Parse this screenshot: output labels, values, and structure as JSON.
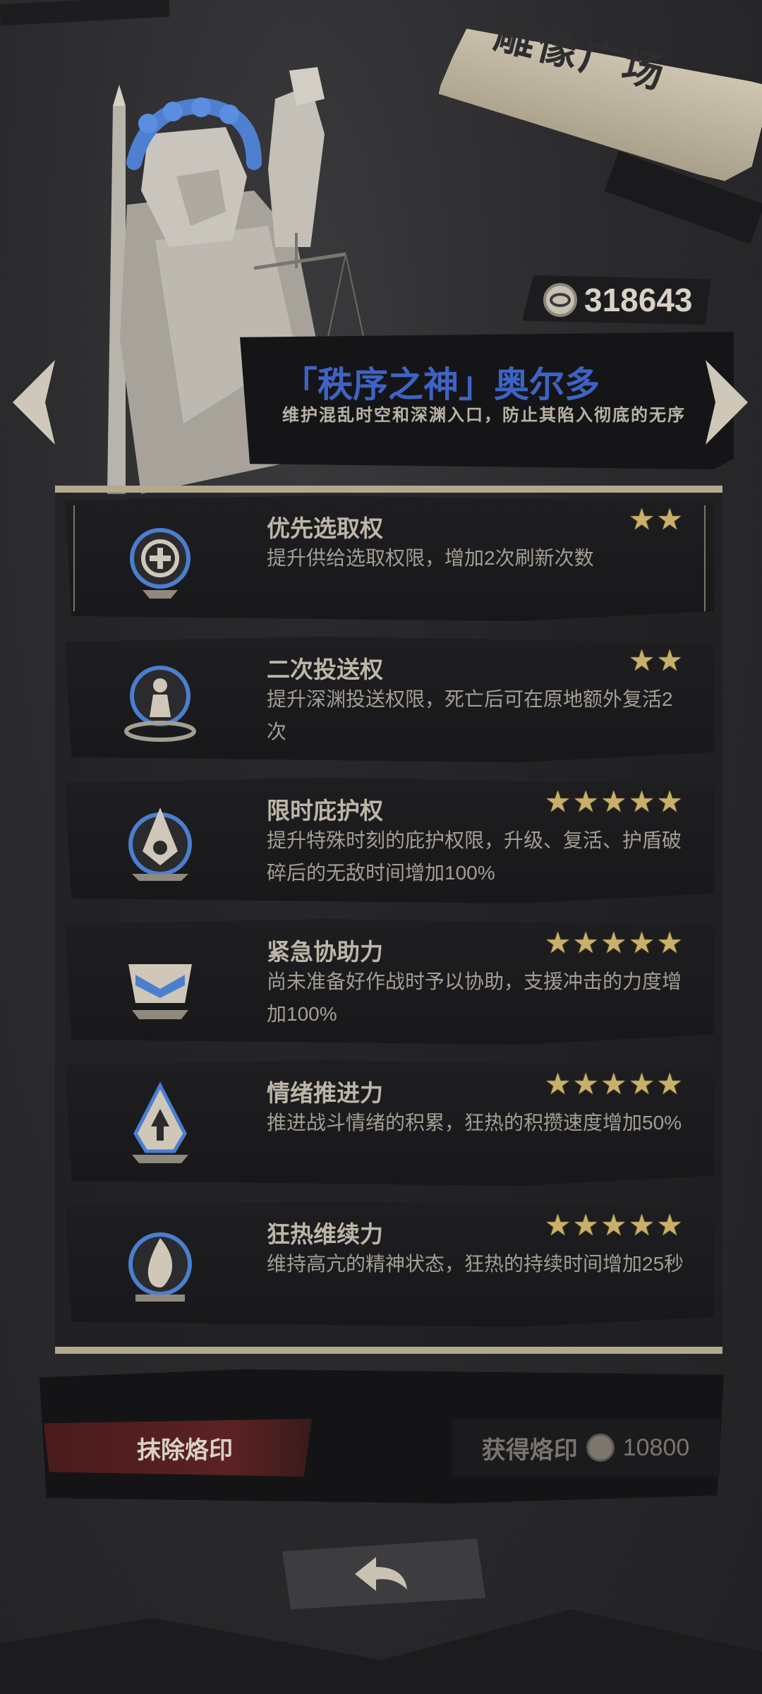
{
  "header": {
    "title": "雕像广场"
  },
  "currency": {
    "icon": "coin-icon",
    "value": "318643"
  },
  "character": {
    "name": "「秩序之神」奥尔多",
    "description": "维护混乱时空和深渊入口，防止其陷入彻底的无序"
  },
  "skills": [
    {
      "name": "优先选取权",
      "description": "提升供给选取权限，增加2次刷新次数",
      "stars": 2,
      "icon": "plus-refresh-icon"
    },
    {
      "name": "二次投送权",
      "description": "提升深渊投送权限，死亡后可在原地额外复活2次",
      "stars": 2,
      "icon": "angel-respawn-icon"
    },
    {
      "name": "限时庇护权",
      "description": "提升特殊时刻的庇护权限，升级、复活、护盾破碎后的无敌时间增加100%",
      "stars": 5,
      "icon": "flame-shield-icon"
    },
    {
      "name": "紧急协助力",
      "description": "尚未准备好作战时予以协助，支援冲击的力度增加100%",
      "stars": 5,
      "icon": "handshake-icon"
    },
    {
      "name": "情绪推进力",
      "description": "推进战斗情绪的积累，狂热的积攒速度增加50%",
      "stars": 5,
      "icon": "arrow-flame-icon"
    },
    {
      "name": "狂热维续力",
      "description": "维持高亢的精神状态，狂热的持续时间增加25秒",
      "stars": 5,
      "icon": "fire-ring-icon"
    }
  ],
  "actions": {
    "erase_label": "抹除烙印",
    "obtain_label": "获得烙印",
    "obtain_cost": "10800"
  },
  "colors": {
    "accent_blue": "#3f63c4",
    "star_gold": "#c9b06a",
    "erase_red": "#5b2224"
  }
}
